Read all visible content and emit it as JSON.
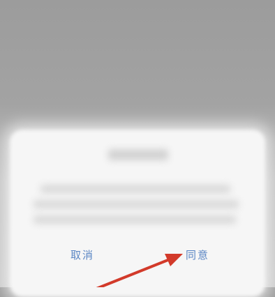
{
  "dialog": {
    "title": "",
    "body": "",
    "cancel_label": "取消",
    "agree_label": "同意"
  },
  "annotation": {
    "arrow_color": "#d23a2a",
    "points_to": "agree-button"
  },
  "colors": {
    "button_text": "#5a86c4",
    "overlay": "#9a9a9a",
    "dialog_bg": "#f6f6f6"
  }
}
